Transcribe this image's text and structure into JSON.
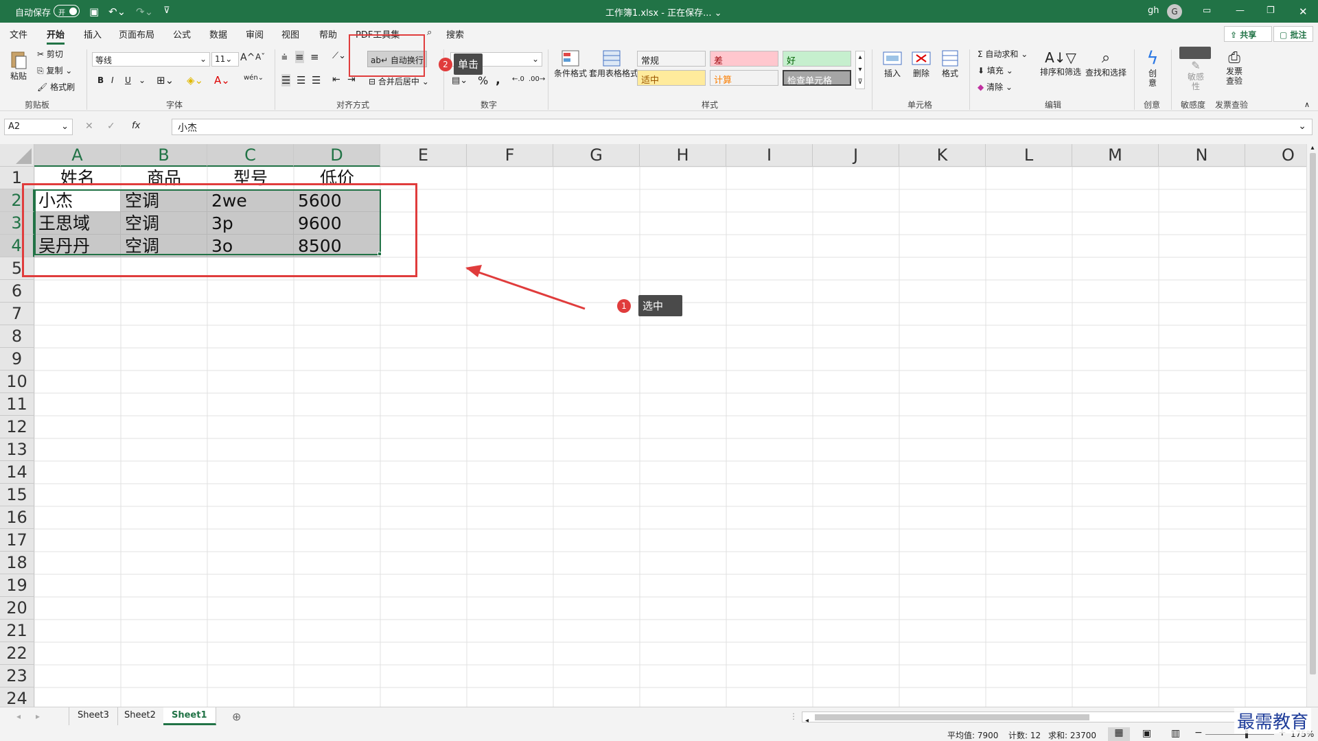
{
  "title_bar": {
    "autosave_label": "自动保存",
    "autosave_state": "开",
    "document_title": "工作簿1.xlsx - 正在保存... ⌄",
    "user_initials": "gh",
    "avatar_letter": "G"
  },
  "menu": {
    "items": [
      "文件",
      "开始",
      "插入",
      "页面布局",
      "公式",
      "数据",
      "审阅",
      "视图",
      "帮助",
      "PDF工具集",
      "搜索"
    ],
    "active": "开始",
    "share_label": "共享",
    "comment_label": "批注"
  },
  "ribbon": {
    "clipboard": {
      "paste": "粘贴",
      "cut": "剪切",
      "copy": "复制",
      "format_painter": "格式刷",
      "label": "剪贴板"
    },
    "font": {
      "name": "等线",
      "size": "11",
      "bold": "B",
      "italic": "I",
      "underline": "U",
      "label": "字体"
    },
    "alignment": {
      "wrap_text": "自动换行",
      "merge_center": "合并后居中",
      "label": "对齐方式"
    },
    "number": {
      "format": "常规",
      "percent": "%",
      "comma": ",",
      "label": "数字"
    },
    "styles": {
      "conditional": "条件格式",
      "table_format": "套用表格格式",
      "cells": [
        {
          "text": "常规",
          "bg": "#ffffff",
          "fg": "#000000"
        },
        {
          "text": "差",
          "bg": "#ffc7ce",
          "fg": "#9c0006"
        },
        {
          "text": "好",
          "bg": "#c6efce",
          "fg": "#006100"
        },
        {
          "text": "适中",
          "bg": "#ffeb9c",
          "fg": "#9c5700"
        },
        {
          "text": "计算",
          "bg": "#f2f2f2",
          "fg": "#fa7d00"
        },
        {
          "text": "检查单元格",
          "bg": "#a5a5a5",
          "fg": "#ffffff"
        }
      ],
      "label": "样式"
    },
    "cells": {
      "insert": "插入",
      "delete": "删除",
      "format": "格式",
      "label": "单元格"
    },
    "editing": {
      "autosum": "自动求和",
      "fill": "填充",
      "clear": "清除",
      "sort_filter": "排序和筛选",
      "find_select": "查找和选择",
      "label": "编辑"
    },
    "creative": {
      "button": "创意",
      "label": "创意"
    },
    "sensitivity": {
      "button": "敏感性",
      "label": "敏感度"
    },
    "invoice": {
      "button": "发票查验",
      "label": "发票查验"
    }
  },
  "formula_bar": {
    "name_box": "A2",
    "cancel": "✕",
    "enter": "✓",
    "fx": "fx",
    "content": "小杰"
  },
  "grid": {
    "columns": [
      "A",
      "B",
      "C",
      "D",
      "E",
      "F",
      "G",
      "H",
      "I",
      "J",
      "K",
      "L",
      "M",
      "N",
      "O"
    ],
    "rows": [
      "1",
      "2",
      "3",
      "4",
      "5",
      "6",
      "7",
      "8",
      "9",
      "10",
      "11",
      "12",
      "13",
      "14",
      "15",
      "16",
      "17",
      "18",
      "19",
      "20",
      "21",
      "22",
      "23",
      "24"
    ],
    "headers": [
      "姓名",
      "商品",
      "型号",
      "低价"
    ],
    "data": [
      [
        "小杰",
        "空调",
        "2we",
        "5600"
      ],
      [
        "王思域",
        "空调",
        "3p",
        "9600"
      ],
      [
        "吴丹丹",
        "空调",
        "3o",
        "8500"
      ]
    ]
  },
  "annotations": {
    "select_badge": "1",
    "select_text": "选中",
    "click_badge": "2",
    "click_text": "单击",
    "annotation_color": "#e03c3c"
  },
  "sheets": {
    "tabs": [
      "Sheet3",
      "Sheet2",
      "Sheet1"
    ],
    "active": "Sheet1"
  },
  "status": {
    "average": "平均值: 7900",
    "count": "计数: 12",
    "sum": "求和: 23700",
    "zoom": "175%"
  },
  "watermark": "最需教育"
}
